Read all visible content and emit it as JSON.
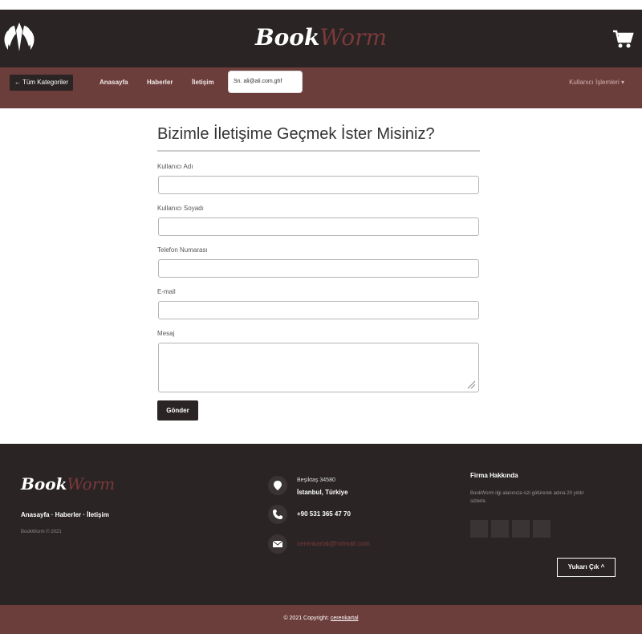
{
  "header": {
    "brand_part1": "Book",
    "brand_part2": "Worm",
    "logo_icon": "wings-shield-icon",
    "cart_icon": "cart-icon"
  },
  "nav": {
    "categories_label": "← Tüm Kategoriler",
    "links": [
      "Anasayfa",
      "Haberler",
      "İletişim"
    ],
    "search_value": "Sn. ali@ali.com.ghf",
    "user_menu": "Kullanıcı İşlemleri ▾"
  },
  "form": {
    "title": "Bizimle İletişime Geçmek İster Misiniz?",
    "fields": [
      {
        "label": "Kullanıcı Adı"
      },
      {
        "label": "Kullanıcı Soyadı"
      },
      {
        "label": "Telefon Numarası"
      },
      {
        "label": "E-mail"
      }
    ],
    "message_label": "Mesaj",
    "submit_label": "Gönder"
  },
  "footer": {
    "brand_part1": "Book",
    "brand_part2": "Worm",
    "links": "Anasayfa · Haberler · İletişim",
    "small_copy": "BookWorm © 2021",
    "address_line1": "Beşiktaş 34580",
    "address_line2": "İstanbul, Türkiye",
    "phone": "+90 531 365 47 70",
    "email": "cerenkartal@hotmail.com",
    "about_title": "Firma Hakkında",
    "about_text": "BookWorm ilgi alanınıza sizi götürerek adına 20 yıldır sizlerle.",
    "up_button": "Yukarı Çık ^",
    "copyright_prefix": "© 2021 Copyright: ",
    "copyright_link": "cerenkartal"
  },
  "colors": {
    "dark": "#2a2424",
    "maroon": "#6b3d3b",
    "accent": "#7a3a3a"
  }
}
